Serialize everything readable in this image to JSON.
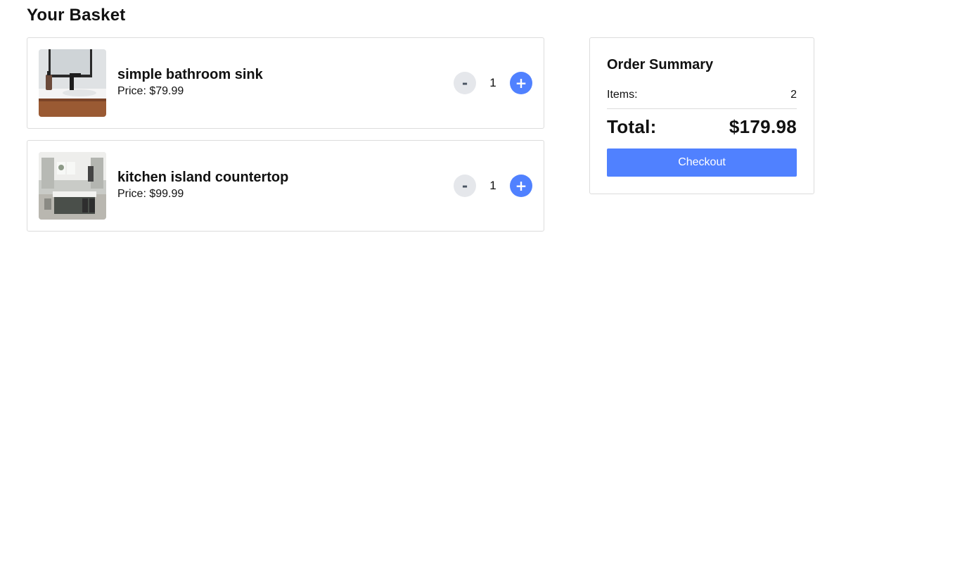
{
  "page": {
    "title": "Your Basket"
  },
  "basket": {
    "items": [
      {
        "name": "simple bathroom sink",
        "price_text": "Price: $79.99",
        "quantity": "1",
        "decrement_label": "-",
        "increment_label": "+",
        "image_icon": "bathroom-sink-photo"
      },
      {
        "name": "kitchen island countertop",
        "price_text": "Price: $99.99",
        "quantity": "1",
        "decrement_label": "-",
        "increment_label": "+",
        "image_icon": "kitchen-island-photo"
      }
    ]
  },
  "summary": {
    "title": "Order Summary",
    "items_label": "Items:",
    "items_count": "2",
    "total_label": "Total:",
    "total_value": "$179.98",
    "checkout_label": "Checkout"
  },
  "colors": {
    "accent": "#5081ff",
    "minus_button_bg": "#e5e7eb",
    "border": "#dcdcdc"
  }
}
